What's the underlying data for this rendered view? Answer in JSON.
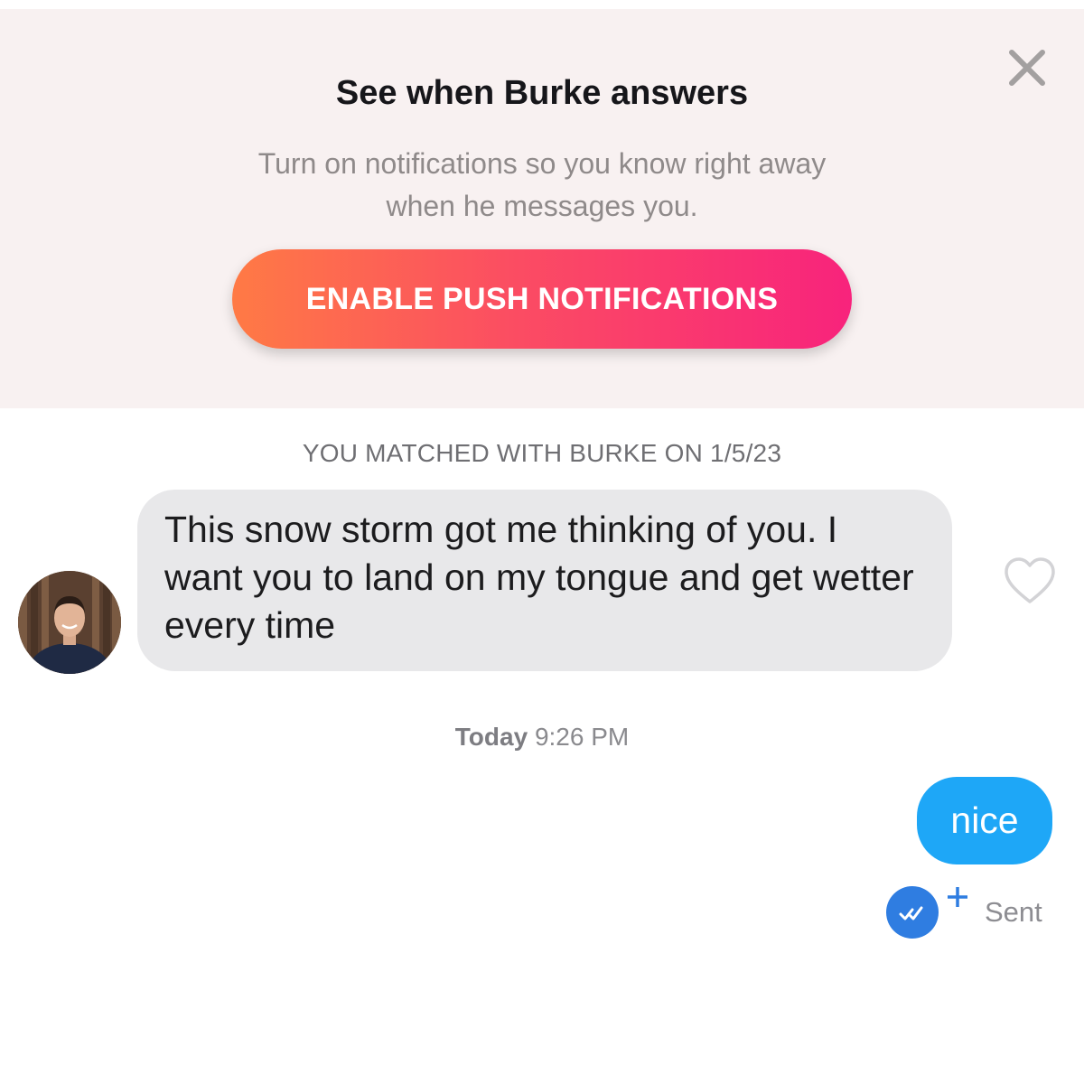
{
  "banner": {
    "title": "See when Burke answers",
    "subtitle": "Turn on notifications so you know right away when he messages you.",
    "button_label": "ENABLE PUSH NOTIFICATIONS",
    "background_color": "#f8f1f1",
    "button_gradient": [
      "#ff7a45",
      "#f8237c"
    ],
    "close_icon": "close-icon"
  },
  "chat": {
    "match_info": "YOU MATCHED WITH BURKE ON 1/5/23",
    "incoming_message": {
      "text": "This snow storm got me thinking of you. I want you to land on my tongue and get wetter every time",
      "avatar_icon": "avatar",
      "like_icon": "heart-icon",
      "bubble_color": "#e8e8ea"
    },
    "timestamp": {
      "day": "Today",
      "time": "9:26 PM"
    },
    "outgoing_message": {
      "text": "nice",
      "bubble_color": "#1ea7f7",
      "receipt_icon": "double-check-icon",
      "plus_icon": "plus-icon",
      "status": "Sent"
    }
  }
}
